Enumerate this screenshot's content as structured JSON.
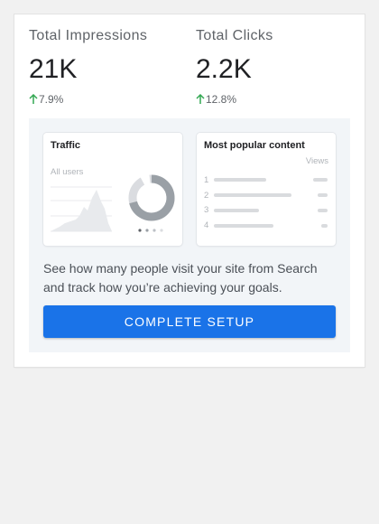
{
  "stats": {
    "impressions": {
      "label": "Total Impressions",
      "value": "21K",
      "change": "7.9%"
    },
    "clicks": {
      "label": "Total Clicks",
      "value": "2.2K",
      "change": "12.8%"
    }
  },
  "colors": {
    "accent": "#1a73e8",
    "trend_up": "#34a853"
  },
  "icons": {
    "trend": "arrow-up-icon"
  },
  "promo": {
    "traffic_card": {
      "title": "Traffic",
      "subtitle": "All users"
    },
    "popular_card": {
      "title": "Most popular content",
      "column_label": "Views",
      "rank_numbers": [
        "1",
        "2",
        "3",
        "4"
      ]
    },
    "description": "See how many people visit your site from Search and track how you’re achieving your goals.",
    "button_label": "COMPLETE SETUP"
  }
}
